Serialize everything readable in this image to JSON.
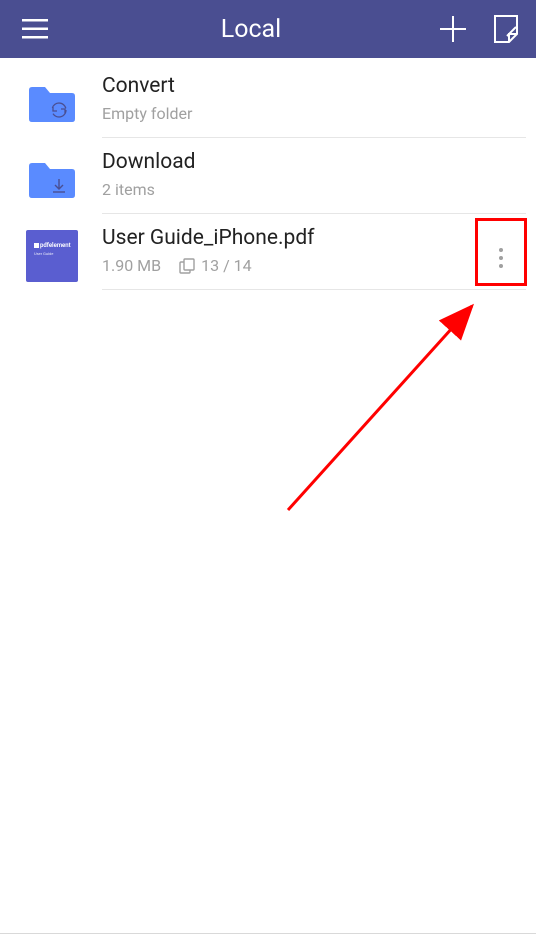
{
  "header": {
    "title": "Local"
  },
  "items": [
    {
      "kind": "folder",
      "title": "Convert",
      "subtitle": "Empty folder",
      "overlay": "sync"
    },
    {
      "kind": "folder",
      "title": "Download",
      "subtitle": "2 items",
      "overlay": "download"
    },
    {
      "kind": "file",
      "title": "User Guide_iPhone.pdf",
      "size": "1.90 MB",
      "pages": "13 / 14",
      "thumb_brand": "pdfelement",
      "thumb_sub": "User Guide"
    }
  ],
  "icons": {
    "menu": "menu-icon",
    "plus": "plus-icon",
    "note": "note-edit-icon",
    "more": "more-vertical-icon"
  },
  "colors": {
    "header_bg": "#4a4e91",
    "folder": "#5a8bff",
    "pdf": "#5a5ed0",
    "annotation": "#ff0000"
  }
}
